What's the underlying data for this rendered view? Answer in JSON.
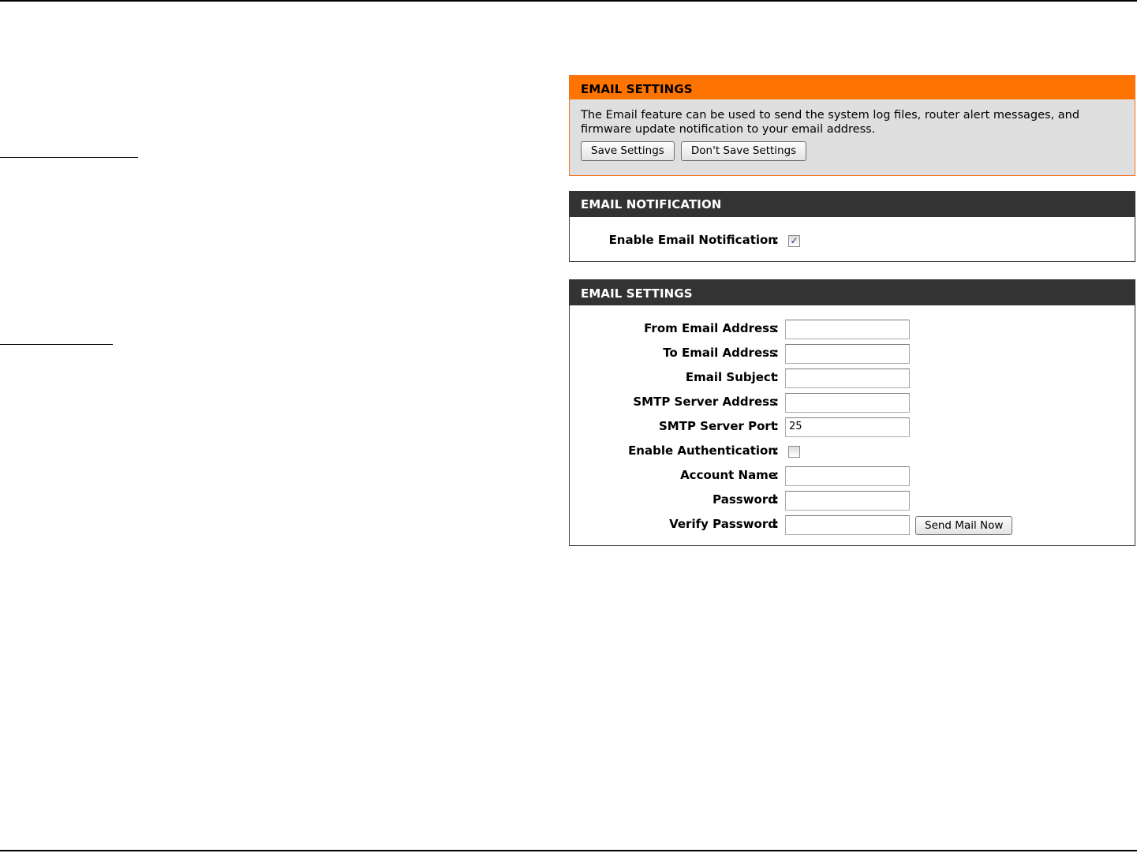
{
  "intro_panel": {
    "title": "EMAIL SETTINGS",
    "description": "The Email feature can be used to send the system log files, router alert messages, and firmware update notification to your email address.",
    "save_label": "Save Settings",
    "dont_save_label": "Don't Save Settings",
    "header_color": "#ff7400"
  },
  "notification_panel": {
    "title": "EMAIL NOTIFICATION",
    "enable_label": "Enable Email Notification",
    "enable_checked": true
  },
  "settings_panel": {
    "title": "EMAIL SETTINGS",
    "colon": ":",
    "fields": {
      "from_label": "From Email Address",
      "from_value": "",
      "to_label": "To Email Address",
      "to_value": "",
      "subject_label": "Email Subject",
      "subject_value": "",
      "smtp_address_label": "SMTP Server Address",
      "smtp_address_value": "",
      "smtp_port_label": "SMTP Server Port",
      "smtp_port_value": "25",
      "auth_label": "Enable Authentication",
      "auth_checked": false,
      "account_label": "Account Name",
      "account_value": "",
      "password_label": "Password",
      "password_value": "",
      "verify_label": "Verify Password",
      "verify_value": ""
    },
    "send_label": "Send Mail Now"
  },
  "checkmark_glyph": "✓"
}
